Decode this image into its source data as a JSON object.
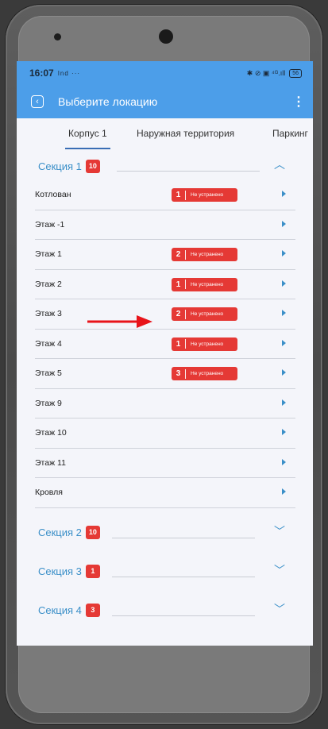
{
  "status_bar": {
    "time": "16:07",
    "carrier": "Ind ···",
    "icons": "✱ ⊘ ▣ ⁴ᴳ.ıll",
    "battery": "56"
  },
  "app_bar": {
    "title": "Выберите локацию"
  },
  "tabs": [
    {
      "label": "Корпус 1",
      "active": true
    },
    {
      "label": "Наружная территория",
      "active": false
    },
    {
      "label": "Паркинг",
      "active": false
    }
  ],
  "sections": [
    {
      "label": "Секция 1",
      "count": "10",
      "expanded": true
    },
    {
      "label": "Секция 2",
      "count": "10",
      "expanded": false
    },
    {
      "label": "Секция 3",
      "count": "1",
      "expanded": false
    },
    {
      "label": "Секция 4",
      "count": "3",
      "expanded": false
    }
  ],
  "rows": [
    {
      "label": "Котлован",
      "issues": "1",
      "status": "Не устранено"
    },
    {
      "label": "Этаж -1",
      "issues": null,
      "status": null
    },
    {
      "label": "Этаж 1",
      "issues": "2",
      "status": "Не устранено"
    },
    {
      "label": "Этаж 2",
      "issues": "1",
      "status": "Не устранено"
    },
    {
      "label": "Этаж 3",
      "issues": "2",
      "status": "Не устранено"
    },
    {
      "label": "Этаж 4",
      "issues": "1",
      "status": "Не устранено"
    },
    {
      "label": "Этаж 5",
      "issues": "3",
      "status": "Не устранено"
    },
    {
      "label": "Этаж 9",
      "issues": null,
      "status": null
    },
    {
      "label": "Этаж 10",
      "issues": null,
      "status": null
    },
    {
      "label": "Этаж 11",
      "issues": null,
      "status": null
    },
    {
      "label": "Кровля",
      "issues": null,
      "status": null
    }
  ],
  "colors": {
    "primary": "#4c9ee9",
    "accent": "#3a8fc8",
    "badge": "#e53935",
    "background": "#f4f5fa"
  }
}
